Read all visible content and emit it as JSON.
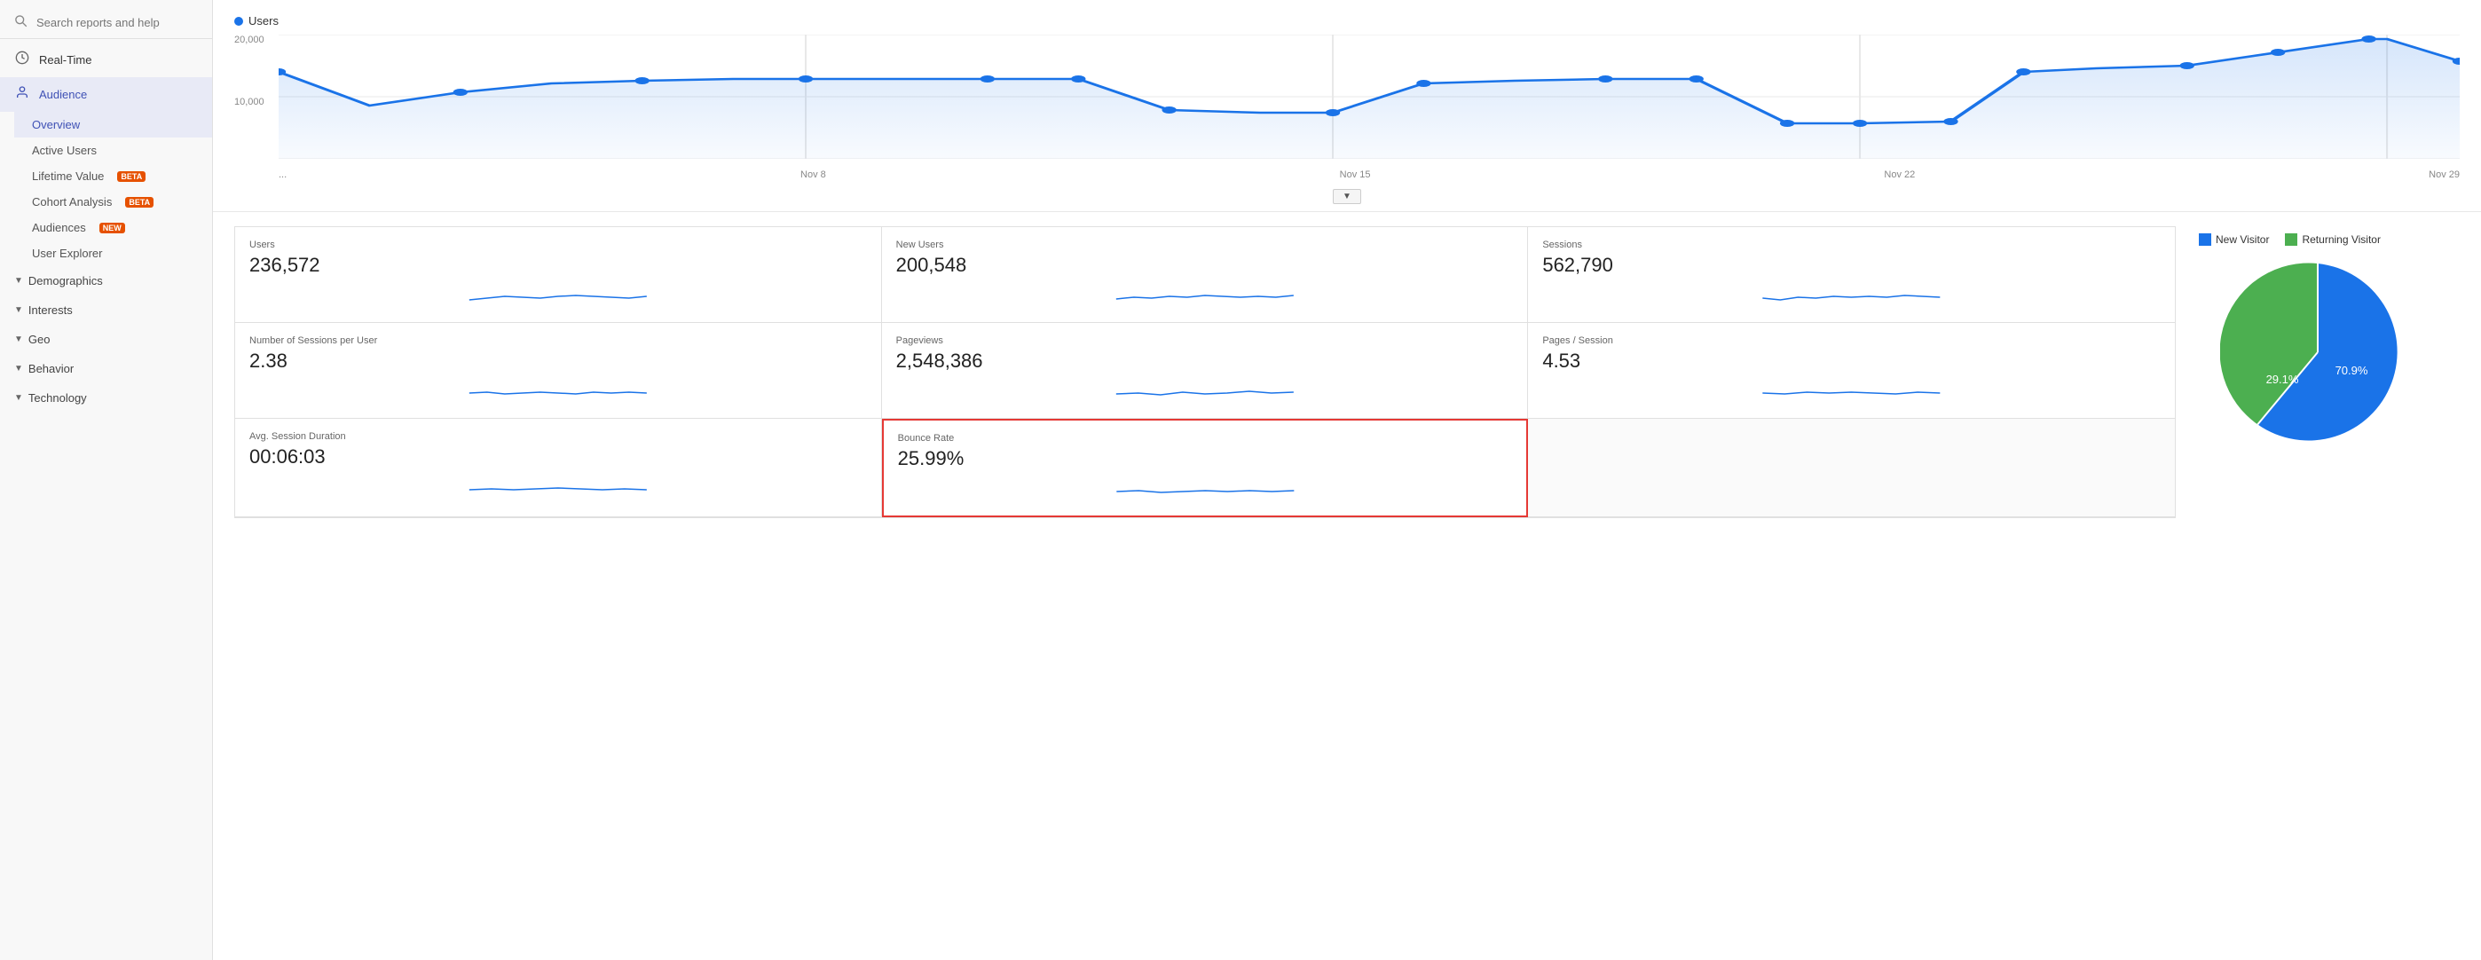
{
  "sidebar": {
    "search_placeholder": "Search reports and help",
    "items": [
      {
        "id": "realtime",
        "label": "Real-Time",
        "icon": "⏱",
        "active": false
      },
      {
        "id": "audience",
        "label": "Audience",
        "icon": "👤",
        "active": true,
        "sub": [
          {
            "id": "overview",
            "label": "Overview",
            "active": true
          },
          {
            "id": "active-users",
            "label": "Active Users",
            "active": false
          },
          {
            "id": "lifetime-value",
            "label": "Lifetime Value",
            "badge": "BETA",
            "badge_class": "badge-beta",
            "active": false
          },
          {
            "id": "cohort-analysis",
            "label": "Cohort Analysis",
            "badge": "BETA",
            "badge_class": "badge-beta",
            "active": false
          },
          {
            "id": "audiences",
            "label": "Audiences",
            "badge": "NEW",
            "badge_class": "badge-new",
            "active": false
          },
          {
            "id": "user-explorer",
            "label": "User Explorer",
            "active": false
          }
        ]
      },
      {
        "id": "demographics",
        "label": "Demographics",
        "collapsible": true
      },
      {
        "id": "interests",
        "label": "Interests",
        "collapsible": true
      },
      {
        "id": "geo",
        "label": "Geo",
        "collapsible": true
      },
      {
        "id": "behavior",
        "label": "Behavior",
        "collapsible": true
      },
      {
        "id": "technology",
        "label": "Technology",
        "collapsible": true
      }
    ]
  },
  "chart": {
    "legend_label": "Users",
    "legend_color": "#1a73e8",
    "y_labels": [
      "20,000",
      "10,000"
    ],
    "x_labels": [
      "...",
      "Nov 8",
      "Nov 15",
      "Nov 22",
      "Nov 29"
    ],
    "dropdown_arrow": "▼"
  },
  "metrics": [
    {
      "id": "users",
      "label": "Users",
      "value": "236,572"
    },
    {
      "id": "new-users",
      "label": "New Users",
      "value": "200,548"
    },
    {
      "id": "sessions",
      "label": "Sessions",
      "value": "562,790"
    },
    {
      "id": "sessions-per-user",
      "label": "Number of Sessions per User",
      "value": "2.38"
    },
    {
      "id": "pageviews",
      "label": "Pageviews",
      "value": "2,548,386"
    },
    {
      "id": "pages-per-session",
      "label": "Pages / Session",
      "value": "4.53"
    },
    {
      "id": "avg-session-duration",
      "label": "Avg. Session Duration",
      "value": "00:06:03"
    },
    {
      "id": "bounce-rate",
      "label": "Bounce Rate",
      "value": "25.99%",
      "highlighted": true
    }
  ],
  "pie": {
    "legend": [
      {
        "label": "New Visitor",
        "color": "#1a73e8"
      },
      {
        "label": "Returning Visitor",
        "color": "#4caf50"
      }
    ],
    "slices": [
      {
        "label": "New Visitor",
        "pct": 70.9,
        "color": "#1a73e8"
      },
      {
        "label": "Returning Visitor",
        "pct": 29.1,
        "color": "#4caf50"
      }
    ],
    "new_pct": "70.9%",
    "returning_pct": "29.1%"
  }
}
